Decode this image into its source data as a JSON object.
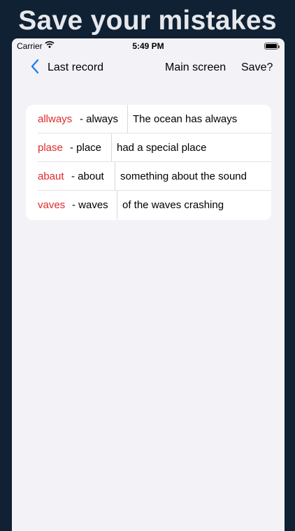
{
  "headline": "Save your mistakes",
  "statusbar": {
    "carrier": "Carrier",
    "time": "5:49 PM",
    "wifi_icon": "wifi-icon",
    "battery_icon": "battery-icon"
  },
  "navbar": {
    "back_label": "Last record",
    "main_screen_label": "Main screen",
    "save_label": "Save?"
  },
  "records": [
    {
      "wrong": "allways",
      "correct": "- always",
      "context": "The ocean has always"
    },
    {
      "wrong": "plase",
      "correct": "- place",
      "context": "had a special place"
    },
    {
      "wrong": "abaut",
      "correct": "- about",
      "context": "something about the sound"
    },
    {
      "wrong": "vaves",
      "correct": "- waves",
      "context": "of the waves crashing"
    }
  ],
  "colors": {
    "background": "#0f2133",
    "accent": "#1c7ff0",
    "mistake": "#e02a2a"
  }
}
